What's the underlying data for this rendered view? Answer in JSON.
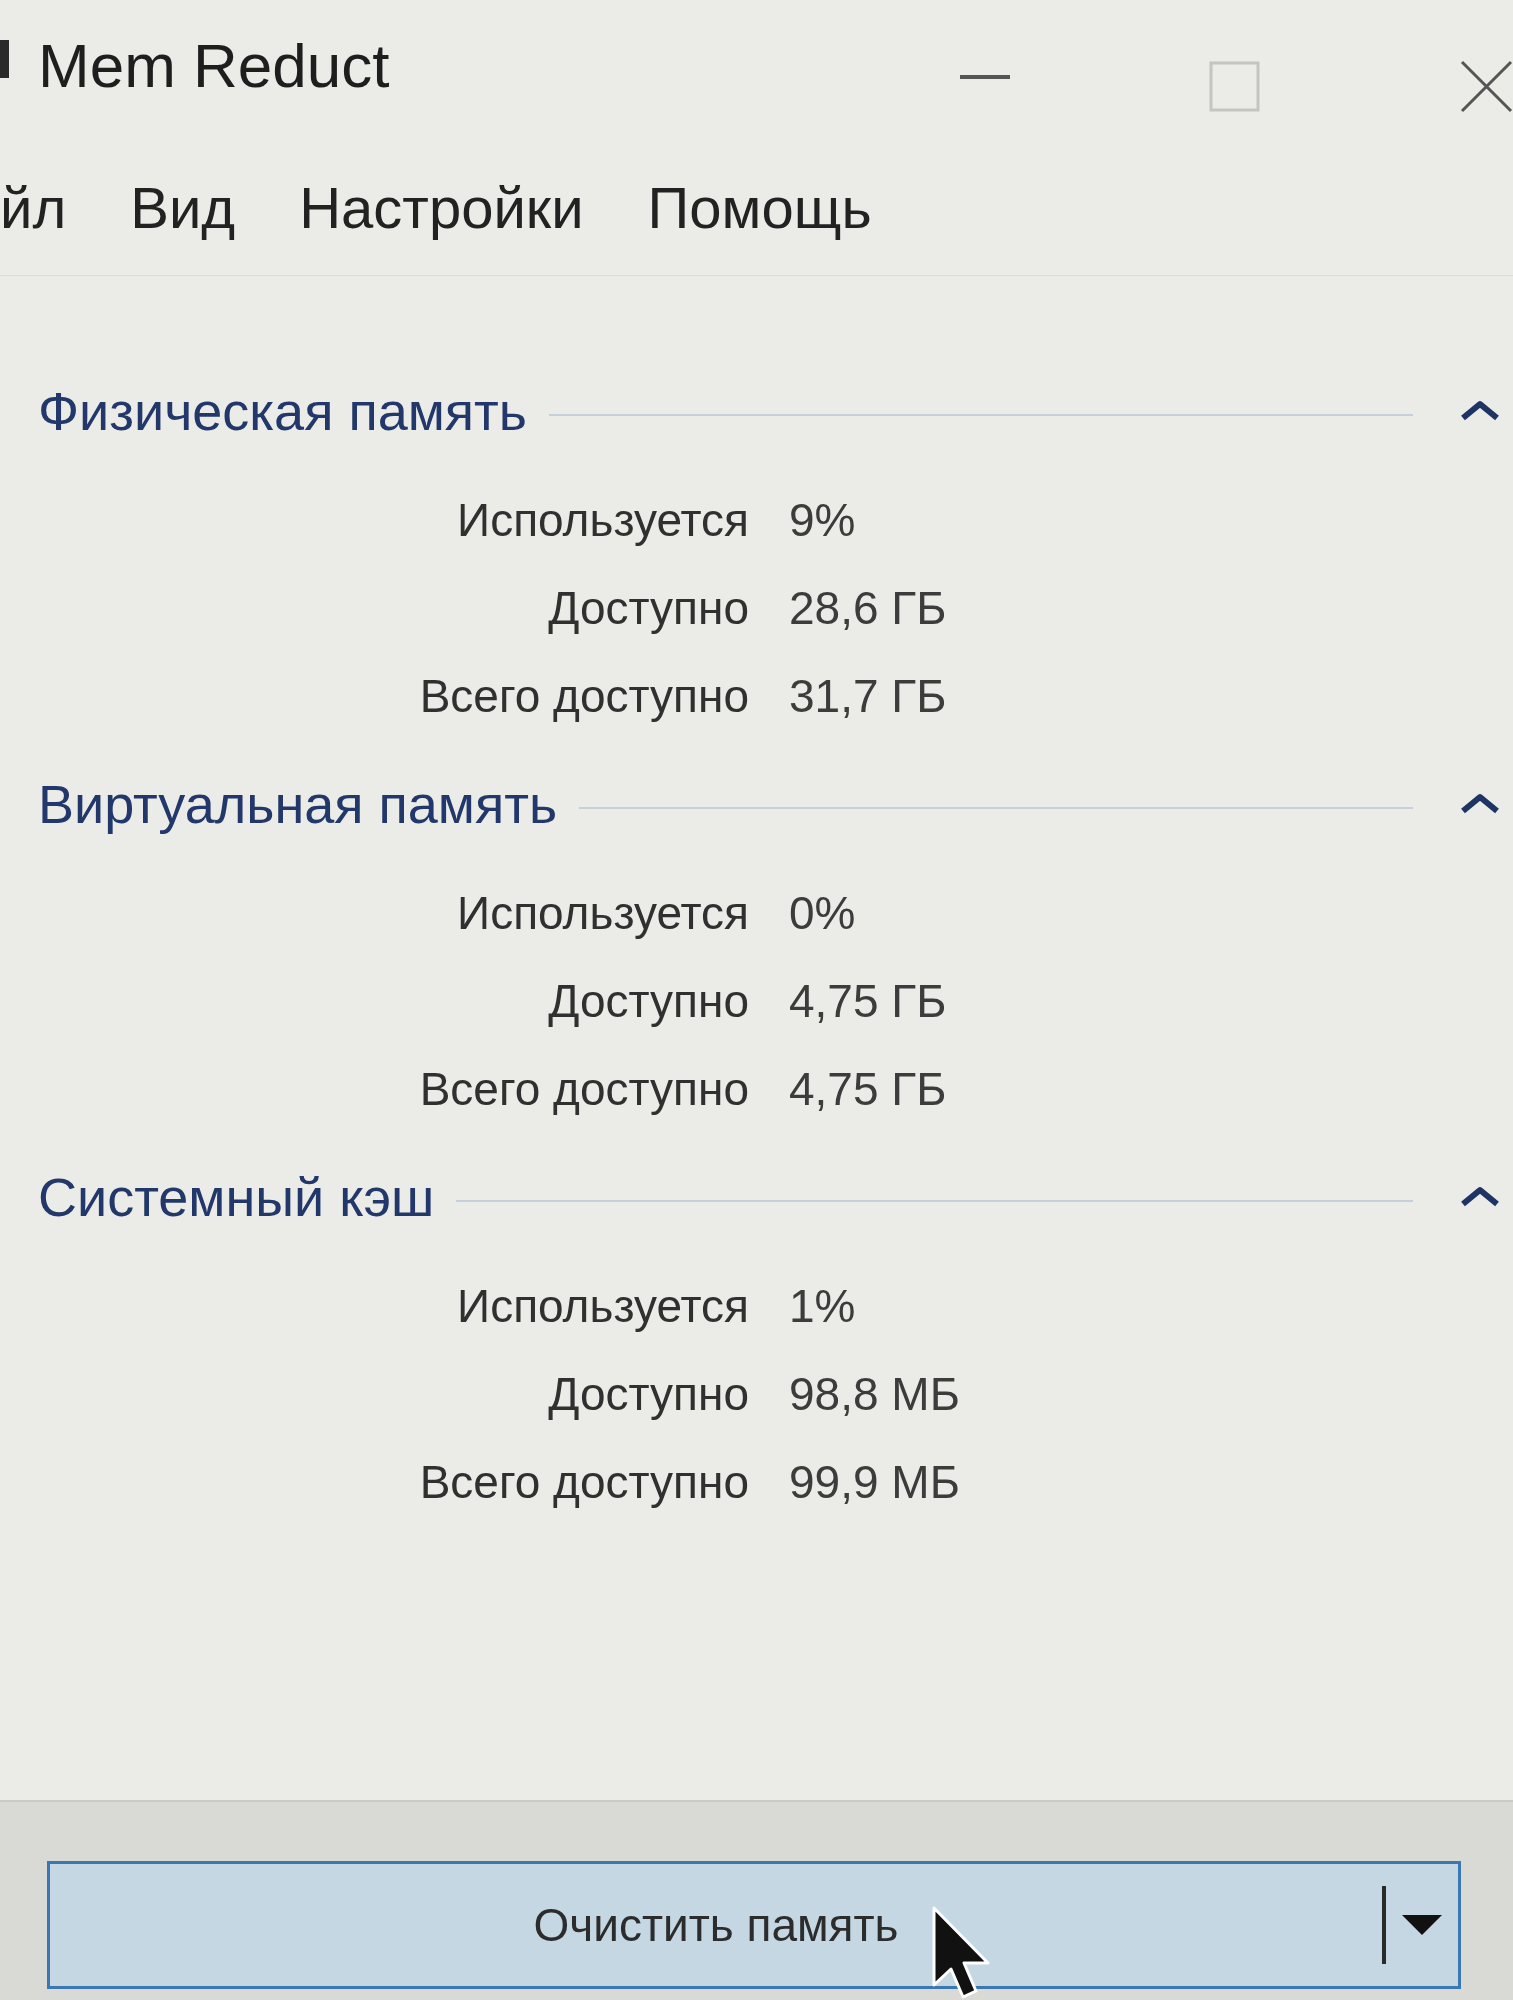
{
  "window": {
    "title": "Mem Reduct"
  },
  "menu": [
    "йл",
    "Вид",
    "Настройки",
    "Помощь"
  ],
  "sections": [
    {
      "title": "Физическая память",
      "expanded": true,
      "rows": [
        {
          "label": "Используется",
          "value": "9%"
        },
        {
          "label": "Доступно",
          "value": "28,6 ГБ"
        },
        {
          "label": "Всего доступно",
          "value": "31,7 ГБ"
        }
      ]
    },
    {
      "title": "Виртуальная память",
      "expanded": true,
      "rows": [
        {
          "label": "Используется",
          "value": "0%"
        },
        {
          "label": "Доступно",
          "value": "4,75 ГБ"
        },
        {
          "label": "Всего доступно",
          "value": "4,75 ГБ"
        }
      ]
    },
    {
      "title": "Системный кэш",
      "expanded": true,
      "rows": [
        {
          "label": "Используется",
          "value": "1%"
        },
        {
          "label": "Доступно",
          "value": "98,8 МБ"
        },
        {
          "label": "Всего доступно",
          "value": "99,9 МБ"
        }
      ]
    }
  ],
  "clean_button": {
    "label": "Очистить память"
  }
}
